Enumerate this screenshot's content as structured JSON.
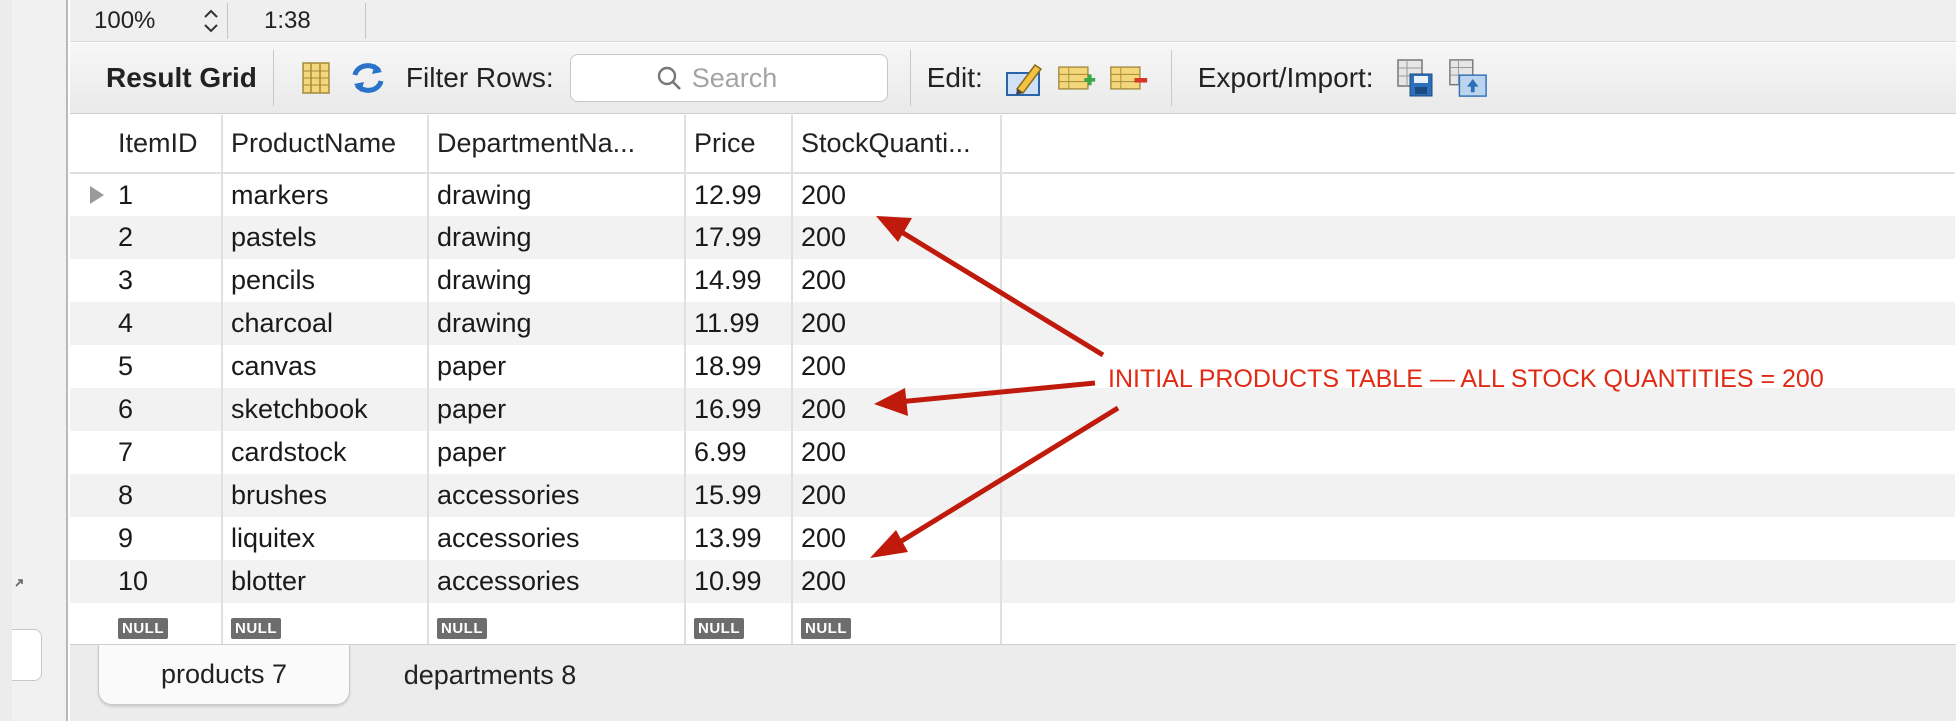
{
  "status": {
    "zoom": "100%",
    "cursor": "1:38"
  },
  "toolbar": {
    "title": "Result Grid",
    "filter_label": "Filter Rows:",
    "search_placeholder": "Search",
    "edit_label": "Edit:",
    "export_label": "Export/Import:"
  },
  "grid": {
    "columns": [
      "ItemID",
      "ProductName",
      "DepartmentNa...",
      "Price",
      "StockQuanti..."
    ],
    "rows": [
      [
        "1",
        "markers",
        "drawing",
        "12.99",
        "200"
      ],
      [
        "2",
        "pastels",
        "drawing",
        "17.99",
        "200"
      ],
      [
        "3",
        "pencils",
        "drawing",
        "14.99",
        "200"
      ],
      [
        "4",
        "charcoal",
        "drawing",
        "11.99",
        "200"
      ],
      [
        "5",
        "canvas",
        "paper",
        "18.99",
        "200"
      ],
      [
        "6",
        "sketchbook",
        "paper",
        "16.99",
        "200"
      ],
      [
        "7",
        "cardstock",
        "paper",
        "6.99",
        "200"
      ],
      [
        "8",
        "brushes",
        "accessories",
        "15.99",
        "200"
      ],
      [
        "9",
        "liquitex",
        "accessories",
        "13.99",
        "200"
      ],
      [
        "10",
        "blotter",
        "accessories",
        "10.99",
        "200"
      ]
    ],
    "null_label": "NULL"
  },
  "annotation": {
    "text": "INITIAL PRODUCTS TABLE — ALL STOCK QUANTITIES = 200",
    "color": "#e12a14"
  },
  "tabs": [
    {
      "label": "products 7",
      "active": true
    },
    {
      "label": "departments 8",
      "active": false
    }
  ]
}
